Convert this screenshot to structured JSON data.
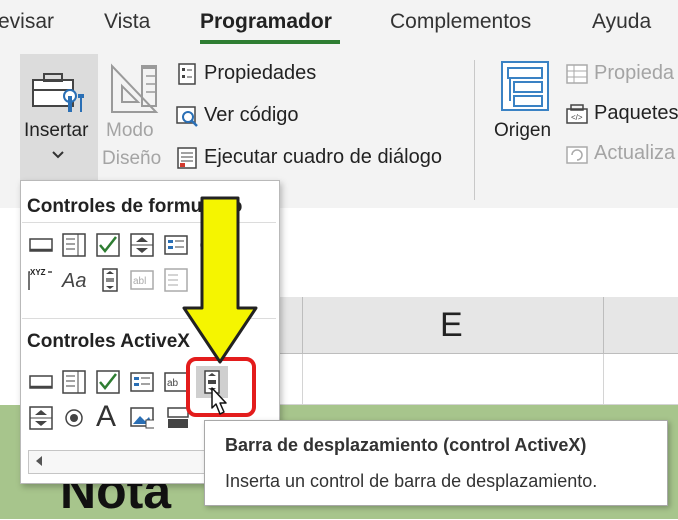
{
  "tabs": [
    {
      "label": "evisar",
      "active": false
    },
    {
      "label": "Vista",
      "active": false
    },
    {
      "label": "Programador",
      "active": true
    },
    {
      "label": "Complementos",
      "active": false
    },
    {
      "label": "Ayuda",
      "active": false
    }
  ],
  "ribbon": {
    "insert_label": "Insertar",
    "design_mode_line1": "Modo",
    "design_mode_line2": "Diseño",
    "properties": "Propiedades",
    "view_code": "Ver código",
    "run_dialog": "Ejecutar cuadro de diálogo",
    "source": "Origen",
    "xml_properties": "Propieda",
    "expansion_packs": "Paquetes",
    "refresh_data": "Actualiza"
  },
  "dropdown": {
    "form_controls_title": "Controles de formulario",
    "activex_title": "Controles ActiveX"
  },
  "sheet": {
    "column_e": "E",
    "cell_text": "Nota"
  },
  "tooltip": {
    "title": "Barra de desplazamiento (control ActiveX)",
    "description": "Inserta un control de barra de desplazamiento."
  },
  "colors": {
    "accent_green": "#2e7d32",
    "highlight_red": "#e31c1c",
    "arrow_yellow": "#f5f500",
    "cell_green": "#a7c58c"
  },
  "icons": [
    "toolbox-icon",
    "design-mode-icon",
    "properties-icon",
    "view-code-icon",
    "run-dialog-icon",
    "source-icon",
    "scrollbar-icon",
    "cursor-icon",
    "down-arrow-icon"
  ]
}
